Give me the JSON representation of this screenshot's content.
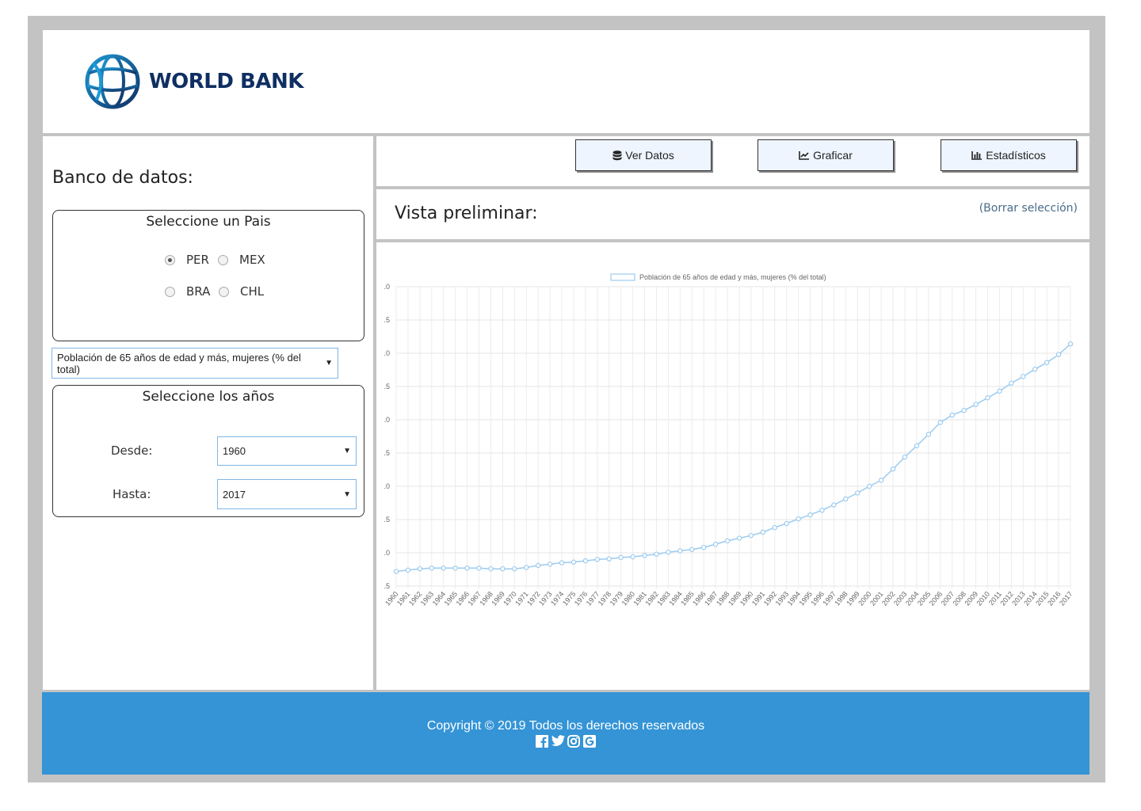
{
  "header": {
    "logo_text": "WORLD BANK"
  },
  "sidebar": {
    "title": "Banco de datos:",
    "country_box": {
      "title": "Seleccione un Pais",
      "options": [
        "PER",
        "MEX",
        "BRA",
        "CHL"
      ],
      "selected": "PER"
    },
    "indicator_select": {
      "value": "Población de 65 años de edad y más, mujeres (% del total)"
    },
    "years_box": {
      "title": "Seleccione los años",
      "from_label": "Desde:",
      "from_value": "1960",
      "to_label": "Hasta:",
      "to_value": "2017"
    }
  },
  "toolbar": {
    "view_data_label": "Ver Datos",
    "plot_label": "Graficar",
    "stats_label": "Estadísticos"
  },
  "preview": {
    "title": "Vista preliminar:",
    "clear_link": "(Borrar selección)"
  },
  "chart_data": {
    "type": "line",
    "legend": [
      "Población de 65 años de edad y más, mujeres (% del total)"
    ],
    "legend_position": "top",
    "series_color": "#9ccbef",
    "grid": true,
    "y_tick_labels": [
      ".0",
      ".5",
      ".0",
      ".5",
      ".0",
      ".5",
      ".0",
      ".5",
      ".0",
      ".5"
    ],
    "x": [
      1960,
      1961,
      1962,
      1963,
      1964,
      1965,
      1966,
      1967,
      1968,
      1969,
      1970,
      1971,
      1972,
      1973,
      1974,
      1975,
      1976,
      1977,
      1978,
      1979,
      1980,
      1981,
      1982,
      1983,
      1984,
      1985,
      1986,
      1987,
      1988,
      1989,
      1990,
      1991,
      1992,
      1993,
      1994,
      1995,
      1996,
      1997,
      1998,
      1999,
      2000,
      2001,
      2002,
      2003,
      2004,
      2005,
      2006,
      2007,
      2008,
      2009,
      2010,
      2011,
      2012,
      2013,
      2014,
      2015,
      2016,
      2017
    ],
    "y": [
      0.22,
      0.24,
      0.26,
      0.27,
      0.27,
      0.27,
      0.27,
      0.27,
      0.26,
      0.26,
      0.26,
      0.28,
      0.31,
      0.33,
      0.35,
      0.36,
      0.38,
      0.4,
      0.41,
      0.43,
      0.44,
      0.46,
      0.48,
      0.51,
      0.53,
      0.55,
      0.58,
      0.63,
      0.68,
      0.72,
      0.76,
      0.81,
      0.88,
      0.94,
      1.01,
      1.07,
      1.14,
      1.22,
      1.31,
      1.4,
      1.5,
      1.59,
      1.76,
      1.94,
      2.11,
      2.28,
      2.46,
      2.57,
      2.64,
      2.73,
      2.83,
      2.93,
      3.05,
      3.15,
      3.26,
      3.36,
      3.48,
      3.64
    ],
    "ylim": [
      0.0,
      4.5
    ]
  },
  "footer": {
    "copyright": "Copyright © 2019 Todos los derechos reservados",
    "social_icons": [
      "facebook-icon",
      "twitter-icon",
      "instagram-icon",
      "google-icon"
    ]
  }
}
